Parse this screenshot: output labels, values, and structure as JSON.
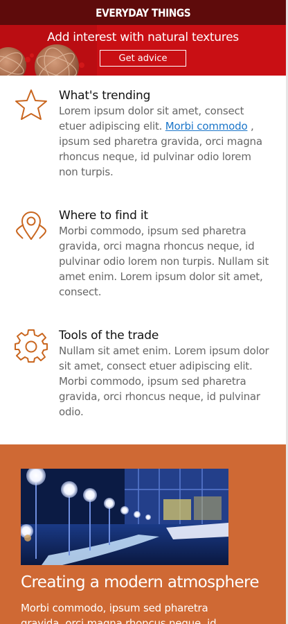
{
  "header": {
    "title": "EVERYDAY THINGS"
  },
  "hero": {
    "headline": "Add interest with natural textures",
    "button_label": "Get advice",
    "image": "rattan-ball-decor"
  },
  "features": [
    {
      "icon": "star-icon",
      "title": "What's trending",
      "text_before": "Lorem ipsum dolor sit amet, consect etuer adipiscing elit. ",
      "link": "Morbi commodo",
      "text_after": " , ipsum sed pharetra gravida, orci magna rhoncus neque, id pulvinar odio lorem non turpis."
    },
    {
      "icon": "map-pin-icon",
      "title": "Where to find it",
      "text": "Morbi commodo, ipsum sed pharetra gravida, orci magna rhoncus neque, id pulvinar odio lorem non turpis. Nullam sit amet enim. Lorem ipsum dolor sit amet, consect."
    },
    {
      "icon": "gear-icon",
      "title": "Tools of the trade",
      "text": "Nullam sit amet enim. Lorem ipsum dolor sit amet, consect etuer adipiscing elit. Morbi commodo, ipsum sed pharetra gravida, orci rhoncus neque, id pulvinar odio."
    }
  ],
  "article": {
    "image": "modern-lounge-photo",
    "title": "Creating a modern atmosphere",
    "text": "Morbi commodo, ipsum sed pharetra gravida, orci magna rhoncus neque, id"
  },
  "colors": {
    "header_bg": "#5e0b0b",
    "hero_bg": "#c90f14",
    "accent_orange": "#cf6934",
    "icon_stroke": "#c9661f",
    "link": "#1a75c9"
  }
}
